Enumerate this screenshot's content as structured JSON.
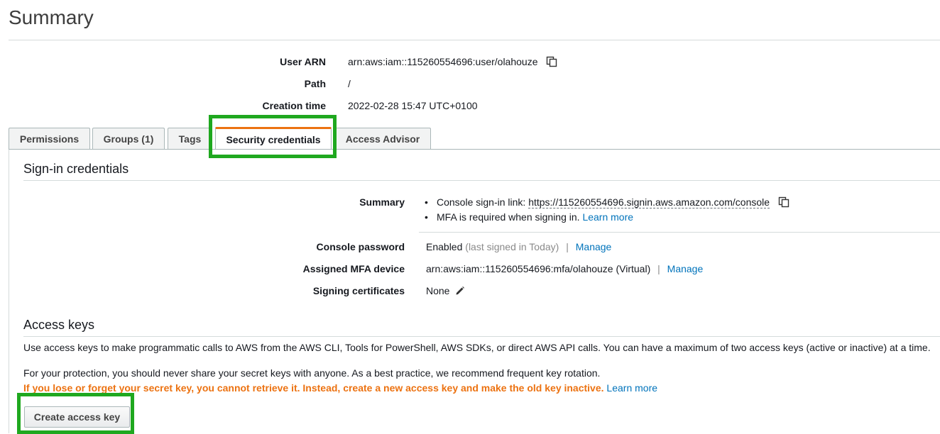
{
  "page": {
    "title": "Summary"
  },
  "summary": {
    "user_arn_label": "User ARN",
    "user_arn_value": "arn:aws:iam::115260554696:user/olahouze",
    "path_label": "Path",
    "path_value": "/",
    "creation_label": "Creation time",
    "creation_value": "2022-02-28 15:47 UTC+0100"
  },
  "tabs": [
    {
      "label": "Permissions"
    },
    {
      "label": "Groups (1)"
    },
    {
      "label": "Tags"
    },
    {
      "label": "Security credentials",
      "active": true
    },
    {
      "label": "Access Advisor"
    }
  ],
  "signin": {
    "title": "Sign-in credentials",
    "summary_label": "Summary",
    "console_link_prefix": "Console sign-in link:",
    "console_link": "https://115260554696.signin.aws.amazon.com/console",
    "mfa_text": "MFA is required when signing in.",
    "learn_more": "Learn more",
    "password_label": "Console password",
    "password_value": "Enabled",
    "password_note": "(last signed in Today)",
    "manage": "Manage",
    "mfa_label": "Assigned MFA device",
    "mfa_value": "arn:aws:iam::115260554696:mfa/olahouze (Virtual)",
    "cert_label": "Signing certificates",
    "cert_value": "None"
  },
  "access_keys": {
    "title": "Access keys",
    "description": "Use access keys to make programmatic calls to AWS from the AWS CLI, Tools for PowerShell, AWS SDKs, or direct AWS API calls. You can have a maximum of two access keys (active or inactive) at a time.",
    "protection": "For your protection, you should never share your secret keys with anyone. As a best practice, we recommend frequent key rotation.",
    "warning": "If you lose or forget your secret key, you cannot retrieve it. Instead, create a new access key and make the old key inactive.",
    "learn_more": "Learn more",
    "create_button": "Create access key"
  },
  "colors": {
    "highlight": "#1fa81f",
    "accent": "#ec7211",
    "link": "#0073bb"
  }
}
